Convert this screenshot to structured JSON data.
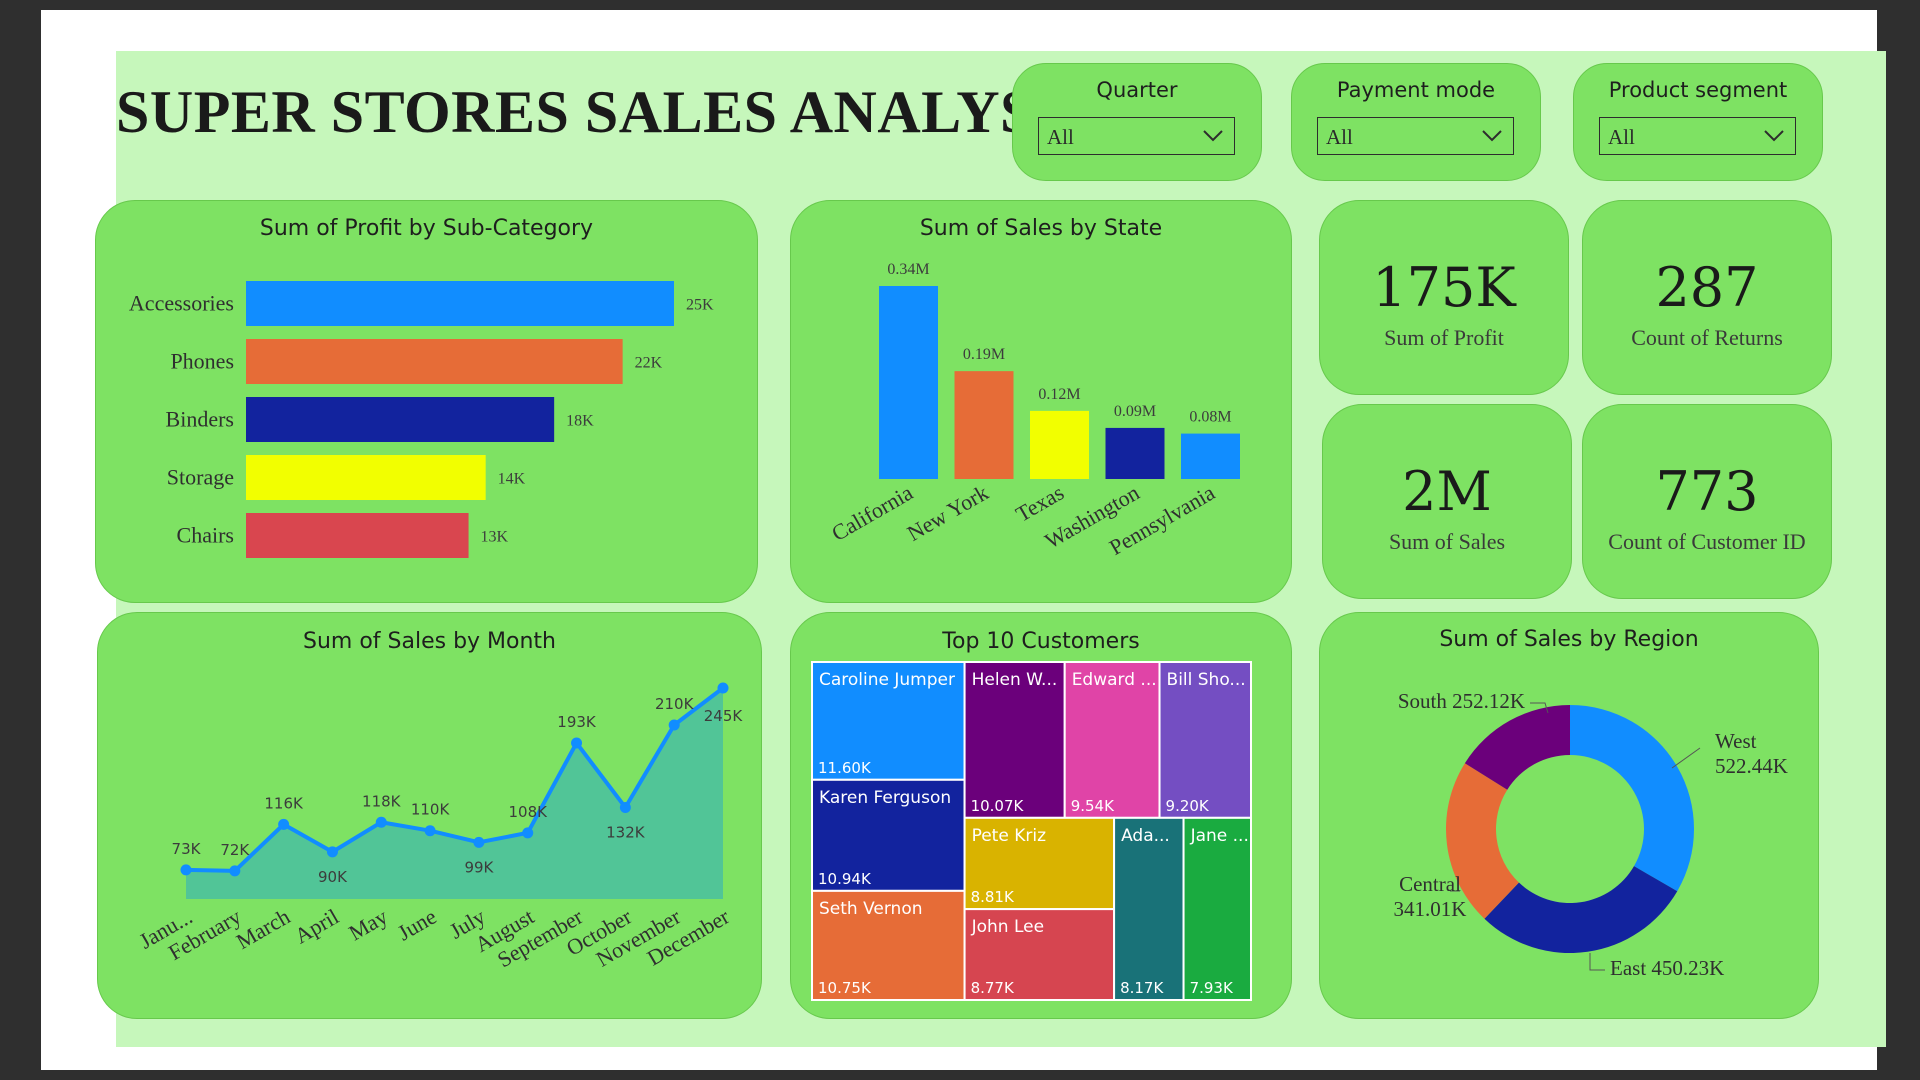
{
  "title": "SUPER STORES SALES ANALYSIS",
  "filters": [
    {
      "label": "Quarter",
      "value": "All"
    },
    {
      "label": "Payment mode",
      "value": "All"
    },
    {
      "label": "Product segment",
      "value": "All"
    }
  ],
  "kpis": [
    {
      "value": "175K",
      "label": "Sum of Profit"
    },
    {
      "value": "287",
      "label": "Count of Returns"
    },
    {
      "value": "2M",
      "label": "Sum of Sales"
    },
    {
      "value": "773",
      "label": "Count of Customer ID"
    }
  ],
  "chart_data": [
    {
      "type": "bar",
      "orientation": "horizontal",
      "title": "Sum of Profit by Sub-Category",
      "categories": [
        "Accessories",
        "Phones",
        "Binders",
        "Storage",
        "Chairs"
      ],
      "values": [
        25,
        22,
        18,
        14,
        13
      ],
      "labels": [
        "25K",
        "22K",
        "18K",
        "14K",
        "13K"
      ],
      "colors": [
        "#118dff",
        "#e66c37",
        "#12239e",
        "#f2ff00",
        "#d9464f"
      ],
      "xlim": [
        0,
        25
      ]
    },
    {
      "type": "bar",
      "title": "Sum of Sales by State",
      "categories": [
        "California",
        "New York",
        "Texas",
        "Washington",
        "Pennsylvania"
      ],
      "values": [
        0.34,
        0.19,
        0.12,
        0.09,
        0.08
      ],
      "labels": [
        "0.34M",
        "0.19M",
        "0.12M",
        "0.09M",
        "0.08M"
      ],
      "colors": [
        "#118dff",
        "#e66c37",
        "#f2ff00",
        "#12239e",
        "#118dff"
      ],
      "ylim": [
        0,
        0.34
      ]
    },
    {
      "type": "area",
      "title": "Sum of Sales by Month",
      "categories": [
        "Janu...",
        "February",
        "March",
        "April",
        "May",
        "June",
        "July",
        "August",
        "September",
        "October",
        "November",
        "December"
      ],
      "values": [
        73,
        72,
        116,
        90,
        118,
        110,
        99,
        108,
        193,
        132,
        210,
        245
      ],
      "labels": [
        "73K",
        "72K",
        "116K",
        "90K",
        "118K",
        "110K",
        "99K",
        "108K",
        "193K",
        "132K",
        "210K",
        "245K"
      ],
      "line_color": "#118dff",
      "fill_color": "#4fc39a",
      "ylim": [
        30,
        250
      ]
    },
    {
      "type": "treemap",
      "title": "Top 10 Customers",
      "items": [
        {
          "name": "Caroline Jumper",
          "value": 11.6,
          "label": "11.60K",
          "color": "#118dff"
        },
        {
          "name": "Karen Ferguson",
          "value": 10.94,
          "label": "10.94K",
          "color": "#12239e"
        },
        {
          "name": "Seth Vernon",
          "value": 10.75,
          "label": "10.75K",
          "color": "#e66c37"
        },
        {
          "name": "Helen W...",
          "value": 10.07,
          "label": "10.07K",
          "color": "#6b007b"
        },
        {
          "name": "Edward ...",
          "value": 9.54,
          "label": "9.54K",
          "color": "#e044a7"
        },
        {
          "name": "Bill Sho...",
          "value": 9.2,
          "label": "9.20K",
          "color": "#744ec2"
        },
        {
          "name": "Pete Kriz",
          "value": 8.81,
          "label": "8.81K",
          "color": "#d9b300"
        },
        {
          "name": "John Lee",
          "value": 8.77,
          "label": "8.77K",
          "color": "#d64550"
        },
        {
          "name": "Ada...",
          "value": 8.17,
          "label": "8.17K",
          "color": "#197278"
        },
        {
          "name": "Jane ...",
          "value": 7.93,
          "label": "7.93K",
          "color": "#1aab40"
        }
      ]
    },
    {
      "type": "pie",
      "title": "Sum of Sales by Region",
      "donut": true,
      "slices": [
        {
          "name": "West",
          "value": 522.44,
          "label": "522.44K",
          "color": "#118dff"
        },
        {
          "name": "East",
          "value": 450.23,
          "label": "450.23K",
          "color": "#12239e"
        },
        {
          "name": "Central",
          "value": 341.01,
          "label": "341.01K",
          "color": "#e66c37"
        },
        {
          "name": "South",
          "value": 252.12,
          "label": "252.12K",
          "color": "#6b007b"
        }
      ]
    }
  ]
}
